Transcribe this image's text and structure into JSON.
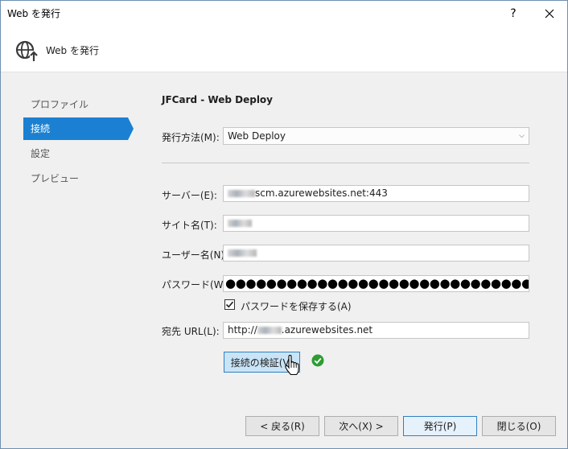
{
  "window": {
    "title": "Web を発行",
    "help": "?"
  },
  "header": {
    "title": "Web を発行",
    "icon": "globe-publish-icon"
  },
  "sidebar": {
    "items": [
      {
        "label": "プロファイル",
        "active": false
      },
      {
        "label": "接続",
        "active": true
      },
      {
        "label": "設定",
        "active": false
      },
      {
        "label": "プレビュー",
        "active": false
      }
    ]
  },
  "main": {
    "profile_title": "JFCard - Web Deploy",
    "publish_method": {
      "label": "発行方法(M):",
      "value": "Web Deploy"
    },
    "server": {
      "label": "サーバー(E):",
      "value_visible": "scm.azurewebsites.net:443"
    },
    "site_name": {
      "label": "サイト名(T):"
    },
    "user_name": {
      "label": "ユーザー名(N):"
    },
    "password": {
      "label": "パスワード(W):",
      "value": "●●●●●●●●●●●●●●●●●●●●●●●●●●●●●●●●●●●●"
    },
    "save_password": {
      "label": "パスワードを保存する(A)",
      "checked": true
    },
    "destination_url": {
      "label": "宛先 URL(L):",
      "prefix": "http://",
      "suffix": ".azurewebsites.net"
    },
    "validate_button": "接続の検証(V)"
  },
  "footer": {
    "back": "< 戻る(R)",
    "next": "次へ(X) >",
    "publish": "発行(P)",
    "close": "閉じる(O)"
  },
  "colors": {
    "accent": "#1b80d1",
    "success": "#2e9c32"
  }
}
